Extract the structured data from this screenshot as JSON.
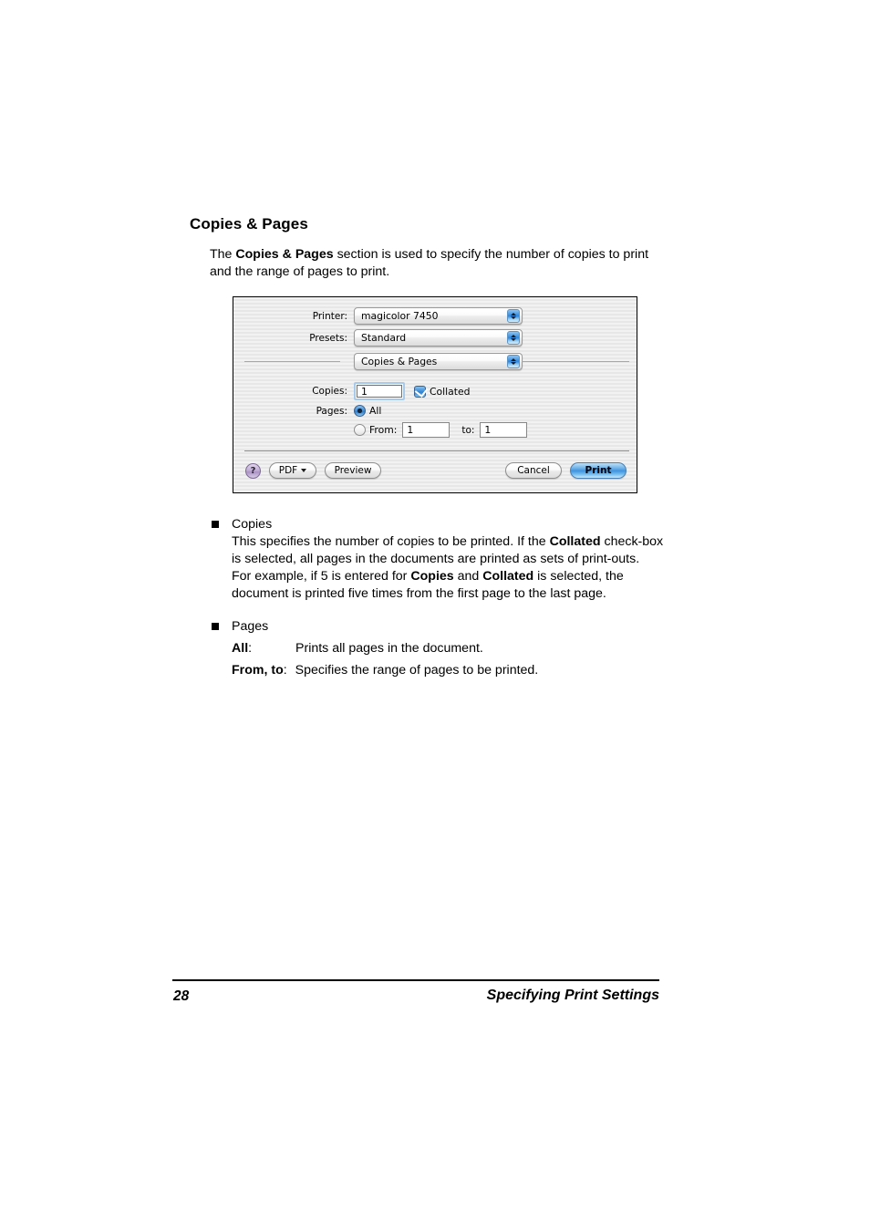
{
  "page": {
    "heading": "Copies & Pages",
    "intro_part1": "The ",
    "intro_bold": "Copies & Pages",
    "intro_part2": " section is used to specify the number of copies to print and the range of pages to print."
  },
  "dialog": {
    "printer_label": "Printer:",
    "printer_value": "magicolor 7450",
    "presets_label": "Presets:",
    "presets_value": "Standard",
    "section_value": "Copies & Pages",
    "copies_label": "Copies:",
    "copies_value": "1",
    "collated_label": "Collated",
    "collated_checked": true,
    "pages_label": "Pages:",
    "all_label": "All",
    "all_selected": true,
    "from_label": "From:",
    "from_value": "1",
    "to_label": "to:",
    "to_value": "1",
    "range_selected": false,
    "help_label": "?",
    "pdf_label": "PDF",
    "preview_label": "Preview",
    "cancel_label": "Cancel",
    "print_label": "Print",
    "accent_blue": "#2f86dc",
    "default_button_blue": "#3f93de",
    "help_purple": "#ab93c6",
    "focus_ring": "#a8caea"
  },
  "bullets": [
    {
      "title": "Copies",
      "lines": [
        {
          "segments": [
            {
              "text": "This specifies the number of copies to be printed. If the ",
              "bold": false
            },
            {
              "text": "Collated",
              "bold": true
            },
            {
              "text": " check-box is selected, all pages in the documents are printed as sets of print-outs.",
              "bold": false
            }
          ]
        },
        {
          "segments": [
            {
              "text": "For example, if 5 is entered for ",
              "bold": false
            },
            {
              "text": "Copies",
              "bold": true
            },
            {
              "text": " and ",
              "bold": false
            },
            {
              "text": "Collated",
              "bold": true
            },
            {
              "text": " is selected, the document is printed five times from the first page to the last page.",
              "bold": false
            }
          ]
        }
      ]
    },
    {
      "title": "Pages",
      "lines": []
    }
  ],
  "definitions": [
    {
      "term": "All",
      "sep": ":",
      "desc": "Prints all pages in the document."
    },
    {
      "term": "From, to",
      "sep": ":",
      "desc": "Specifies the range of pages to be printed."
    }
  ],
  "footer": {
    "page_number": "28",
    "running_title": "Specifying Print Settings"
  }
}
